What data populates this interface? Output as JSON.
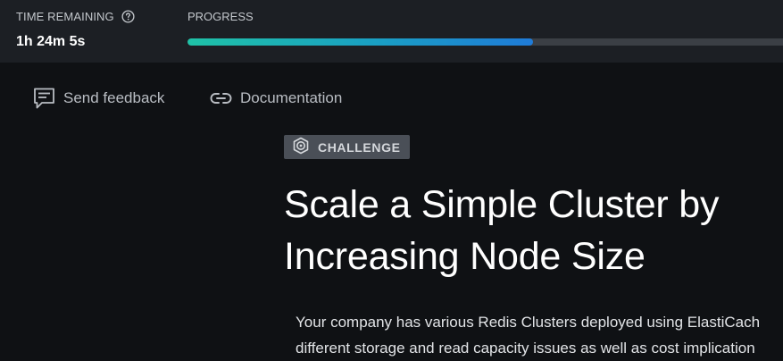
{
  "header": {
    "time_remaining_label": "TIME REMAINING",
    "time_remaining_value": "1h 24m 5s",
    "progress_label": "PROGRESS",
    "progress_fraction": 0.58
  },
  "toolbar": {
    "feedback_label": "Send feedback",
    "feedback_icon": "message-feedback-icon",
    "docs_label": "Documentation",
    "docs_icon": "link-icon"
  },
  "content": {
    "badge_label": "CHALLENGE",
    "badge_icon": "challenge-target-icon",
    "title": "Scale a Simple Cluster by Increasing Node Size",
    "description_lines": [
      "Your company has various Redis Clusters deployed using ElastiCach",
      "different storage and read capacity issues as well as cost implication"
    ]
  },
  "colors": {
    "background": "#0f1114",
    "topbar": "#1c1f24",
    "progress_start": "#1fc2a7",
    "progress_end": "#1f7bd8",
    "badge_bg": "#4a4f57"
  }
}
